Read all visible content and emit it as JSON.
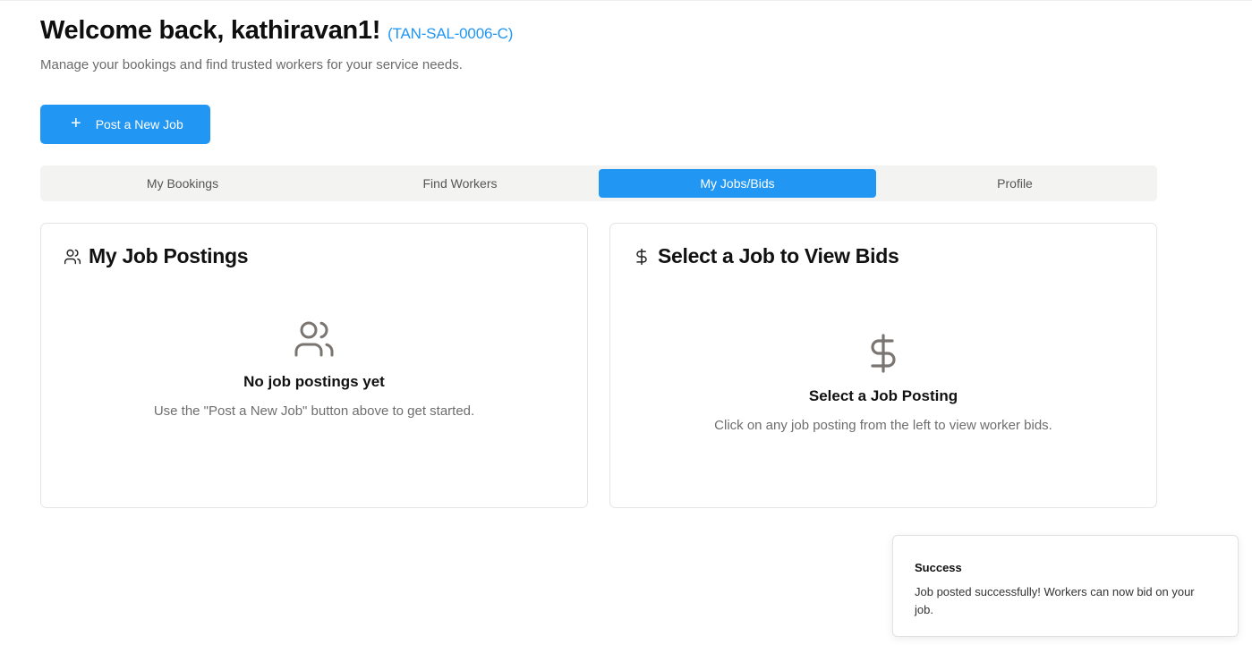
{
  "header": {
    "welcome": "Welcome back, kathiravan1!",
    "user_code": "(TAN-SAL-0006-C)",
    "subtitle": "Manage your bookings and find trusted workers for your service needs."
  },
  "post_job_button": {
    "icon": "plus-icon",
    "label": "Post a New Job"
  },
  "tabs": [
    {
      "label": "My Bookings",
      "active": false
    },
    {
      "label": "Find Workers",
      "active": false
    },
    {
      "label": "My Jobs/Bids",
      "active": true
    },
    {
      "label": "Profile",
      "active": false
    }
  ],
  "job_postings_card": {
    "icon": "users-icon",
    "title": "My Job Postings",
    "empty_icon": "users-icon",
    "empty_title": "No job postings yet",
    "empty_description": "Use the \"Post a New Job\" button above to get started."
  },
  "bids_card": {
    "icon": "dollar-icon",
    "title": "Select a Job to View Bids",
    "empty_icon": "dollar-icon",
    "empty_title": "Select a Job Posting",
    "empty_description": "Click on any job posting from the left to view worker bids."
  },
  "toast": {
    "title": "Success",
    "message": "Job posted successfully! Workers can now bid on your job."
  },
  "colors": {
    "accent": "#2196f3",
    "tab_background": "#f3f3f2",
    "muted_text": "#6e6e6e"
  }
}
